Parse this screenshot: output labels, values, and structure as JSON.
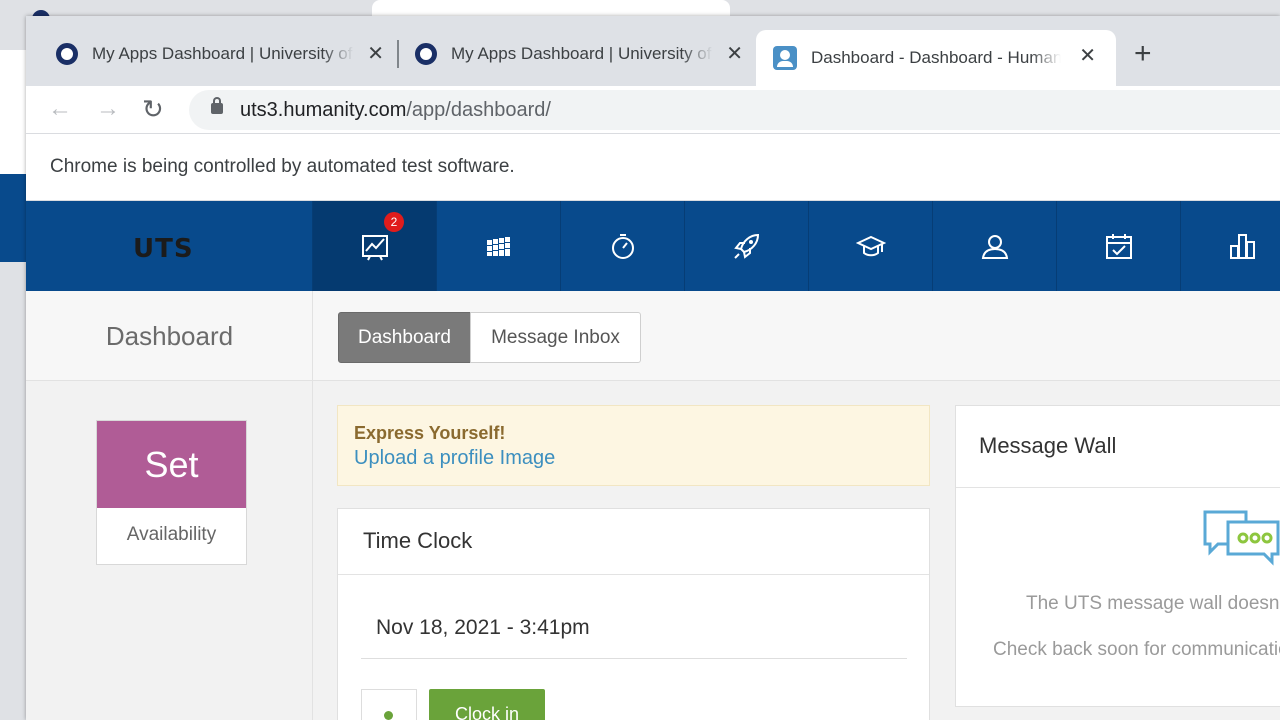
{
  "browser": {
    "tabs": [
      {
        "title": "My Apps Dashboard | University of Technology Sydney"
      },
      {
        "title": "My Apps Dashboard | University of Technology Sydney"
      },
      {
        "title": "Dashboard - Dashboard - Humanity"
      }
    ],
    "close_symbol": "✕",
    "new_tab_symbol": "+",
    "url_host": "uts3.humanity.com",
    "url_path": "/app/dashboard/",
    "infobar_text": "Chrome is being controlled by automated test software."
  },
  "app": {
    "logo_text": "UTS",
    "nav": [
      {
        "icon": "dashboard-chart-icon",
        "badge": "2",
        "active": true
      },
      {
        "icon": "schedule-grid-icon"
      },
      {
        "icon": "stopwatch-icon"
      },
      {
        "icon": "rocket-icon"
      },
      {
        "icon": "graduation-cap-icon"
      },
      {
        "icon": "user-icon"
      },
      {
        "icon": "calendar-check-icon"
      },
      {
        "icon": "bar-chart-icon"
      }
    ],
    "page_title": "Dashboard",
    "tabs": {
      "dashboard": "Dashboard",
      "inbox": "Message Inbox"
    },
    "availability": {
      "top": "Set",
      "bottom": "Availability"
    },
    "express": {
      "heading": "Express Yourself!",
      "link": "Upload a profile Image"
    },
    "time_clock": {
      "title": "Time Clock",
      "datetime": "Nov 18, 2021 - 3:41pm",
      "button": "Clock in"
    },
    "message_wall": {
      "title": "Message Wall",
      "line1": "The UTS message wall doesn't have any messages yet.",
      "line2": "Check back soon for communications from your team."
    },
    "colors": {
      "nav_bg": "#084a8c",
      "availability": "#b05c96",
      "clock_in": "#6aa33a",
      "link": "#3c8fbf"
    }
  }
}
